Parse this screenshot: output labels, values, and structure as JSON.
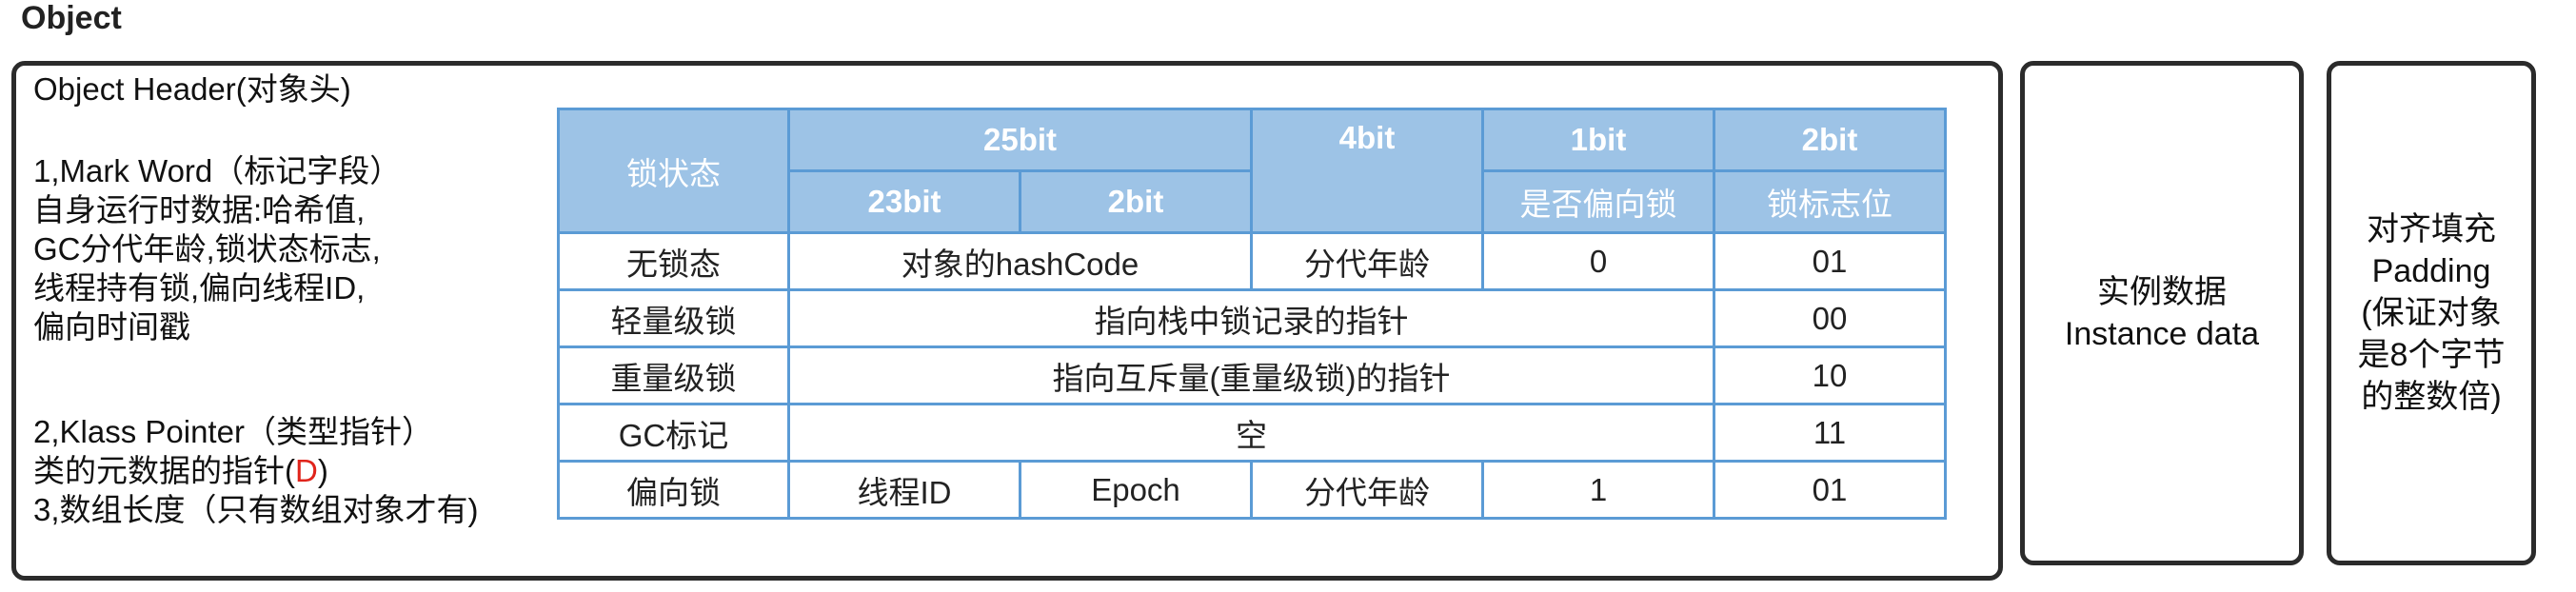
{
  "title": "Object",
  "object_header": {
    "title": "Object Header(对象头)",
    "mark_word_lines": [
      "1,Mark Word（标记字段）",
      "自身运行时数据:哈希值,",
      "GC分代年龄,锁状态标志,",
      "线程持有锁,偏向线程ID,",
      "偏向时间戳"
    ],
    "klass_title": "2,Klass Pointer（类型指针）",
    "klass_desc_prefix": "类的元数据的指针(",
    "klass_desc_letter": "D",
    "klass_desc_suffix": ")",
    "array_length": "3,数组长度（只有数组对象才有)"
  },
  "table": {
    "header1": {
      "lock_state": "锁状态",
      "bits25": "25bit",
      "bits4": "4bit",
      "bits1": "1bit",
      "bits2": "2bit"
    },
    "header2": {
      "bits23": "23bit",
      "bits2": "2bit",
      "biased_flag": "是否偏向锁",
      "lock_flag": "锁标志位"
    },
    "rows": {
      "unlocked": {
        "state": "无锁态",
        "hash": "对象的hashCode",
        "age": "分代年龄",
        "biased": "0",
        "flag": "01"
      },
      "lightweight": {
        "state": "轻量级锁",
        "pointer": "指向栈中锁记录的指针",
        "flag": "00"
      },
      "heavyweight": {
        "state": "重量级锁",
        "pointer": "指向互斥量(重量级锁)的指针",
        "flag": "10"
      },
      "gc": {
        "state": "GC标记",
        "content": "空",
        "flag": "11"
      },
      "biased": {
        "state": "偏向锁",
        "thread": "线程ID",
        "epoch": "Epoch",
        "age": "分代年龄",
        "biased": "1",
        "flag": "01"
      }
    }
  },
  "instance_data": {
    "line1": "实例数据",
    "line2": "Instance data"
  },
  "padding": {
    "lines": [
      "对齐填充",
      "Padding",
      "(保证对象",
      "是8个字节",
      "的整数倍)"
    ]
  },
  "colors": {
    "table_header_bg": "#9dc3e6",
    "table_border": "#5b9bd5",
    "accent_red": "#e0241b",
    "box_border": "#2b2b2b"
  }
}
